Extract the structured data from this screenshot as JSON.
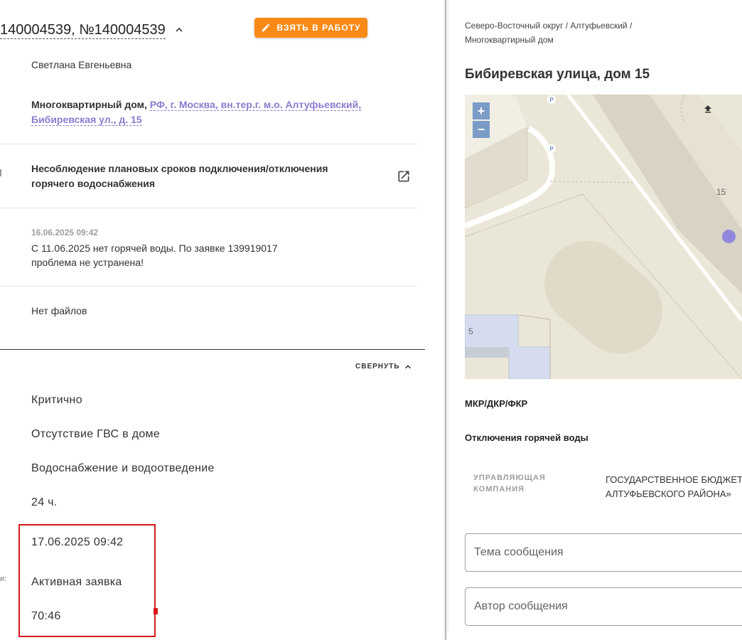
{
  "ticket": {
    "title": "140004539, №140004539",
    "take_button_label": "ВЗЯТЬ В РАБОТУ",
    "author": "Светлана Евгеньевна",
    "object_type": "Многоквартирный дом, ",
    "object_address": "РФ, г. Москва, вн.тер.г. м.о. Алтуфьевский, Бибиревская ул., д. 15",
    "problem": "Несоблюдение плановых сроков подключения/отключения горячего водоснабжения",
    "message_date": "16.06.2025 09:42",
    "message_text_line1": "С 11.06.2025 нет горячей воды. По заявке 139919017",
    "message_text_line2": "проблема не устранена!",
    "files": "Нет файлов",
    "collapse_label": "СВЕРНУТЬ",
    "priority": "Критично",
    "category": "Отсутствие ГВС в доме",
    "service": "Водоснабжение и водоотведение",
    "deadline": "24 ч.",
    "due_date": "17.06.2025 09:42",
    "status": "Активная заявка",
    "timer": "70:46",
    "partial_label": "и:"
  },
  "right": {
    "breadcrumb_line1": "Северо-Восточный округ / Алтуфьевский /",
    "breadcrumb_line2": "Многоквартирный дом",
    "address_title": "Бибиревская улица, дом 15",
    "map": {
      "zoom_in": "+",
      "zoom_out": "−",
      "house_number_main": "15",
      "house_number_left": "5",
      "parking": "P"
    },
    "program_label": "МКР/ДКР/ФКР",
    "outage_label": "Отключения горячей воды",
    "uk_label_line1": "УПРАВЛЯЮЩАЯ",
    "uk_label_line2": "КОМПАНИЯ",
    "uk_value_line1": "ГОСУДАРСТВЕННОЕ БЮДЖЕТ",
    "uk_value_line2": "АЛТУФЬЕВСКОГО РАЙОНА»",
    "subject_placeholder": "Тема сообщения",
    "author_placeholder": "Автор сообщения"
  },
  "colors": {
    "accent_orange": "#f98a16",
    "link_purple": "#8e7bd0",
    "highlight_red": "#d9191c",
    "map_marker": "#8a7fe0"
  }
}
